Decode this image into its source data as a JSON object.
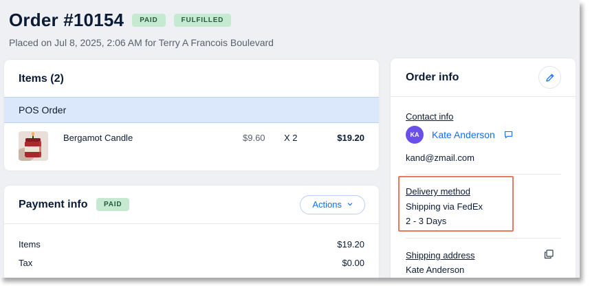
{
  "header": {
    "order_title": "Order #10154",
    "paid_badge": "PAID",
    "fulfilled_badge": "FULFILLED",
    "placed_text": "Placed on Jul 8, 2025, 2:06 AM for Terry A Francois Boulevard"
  },
  "items": {
    "title": "Items (2)",
    "group_label": "POS Order",
    "rows": [
      {
        "name": "Bergamot Candle",
        "price": "$9.60",
        "qty": "X 2",
        "total": "$19.20",
        "thumb_icon": "candle-thumbnail"
      }
    ]
  },
  "payment": {
    "title": "Payment info",
    "badge": "PAID",
    "actions_label": "Actions",
    "rows": [
      {
        "label": "Items",
        "value": "$19.20"
      },
      {
        "label": "Tax",
        "value": "$0.00"
      }
    ]
  },
  "order_info": {
    "title": "Order info",
    "edit_icon": "pencil-icon",
    "contact_label": "Contact info",
    "avatar_initials": "KA",
    "contact_name": "Kate Anderson",
    "contact_email": "kand@zmail.com",
    "delivery_label": "Delivery method",
    "delivery_method": "Shipping via FedEx",
    "delivery_time": "2 - 3 Days",
    "shipping_label": "Shipping address",
    "shipping_name": "Kate Anderson"
  },
  "colors": {
    "page_bg": "#eef0f4",
    "badge_bg": "#c6e9d2",
    "accent_blue": "#116dff",
    "pos_bar_bg": "#dbe8fb",
    "avatar_bg": "#6a4fe8",
    "highlight_border": "#e8795f"
  }
}
